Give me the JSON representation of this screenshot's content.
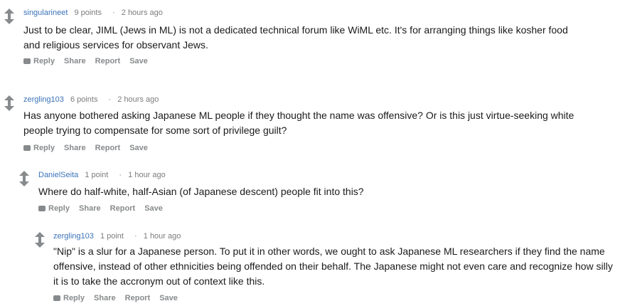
{
  "comments": [
    {
      "author": "singularineet",
      "points": "9 points",
      "time": "2 hours ago",
      "text": "Just to be clear, JIML (Jews in ML) is not a dedicated technical forum like WiML etc. It's for arranging things like kosher food and religious services for observant Jews.",
      "actions": {
        "reply": "Reply",
        "share": "Share",
        "report": "Report",
        "save": "Save"
      }
    },
    {
      "author": "zergling103",
      "points": "6 points",
      "time": "2 hours ago",
      "text": "Has anyone bothered asking Japanese ML people if they thought the name was offensive? Or is this just virtue-seeking white people trying to compensate for some sort of privilege guilt?",
      "actions": {
        "reply": "Reply",
        "share": "Share",
        "report": "Report",
        "save": "Save"
      }
    },
    {
      "author": "DanielSeita",
      "points": "1 point",
      "time": "1 hour ago",
      "text": "Where do half-white, half-Asian (of Japanese descent) people fit into this?",
      "actions": {
        "reply": "Reply",
        "share": "Share",
        "report": "Report",
        "save": "Save"
      }
    },
    {
      "author": "zergling103",
      "points": "1 point",
      "time": "1 hour ago",
      "text": "\"Nip\" is a slur for a Japanese person. To put it in other words, we ought to ask Japanese ML researchers if they find the name offensive, instead of other ethnicities being offended on their behalf. The Japanese might not even care and recognize how silly it is to take the accronym out of context like this.",
      "actions": {
        "reply": "Reply",
        "share": "Share",
        "report": "Report",
        "save": "Save"
      }
    }
  ],
  "sep": "·"
}
